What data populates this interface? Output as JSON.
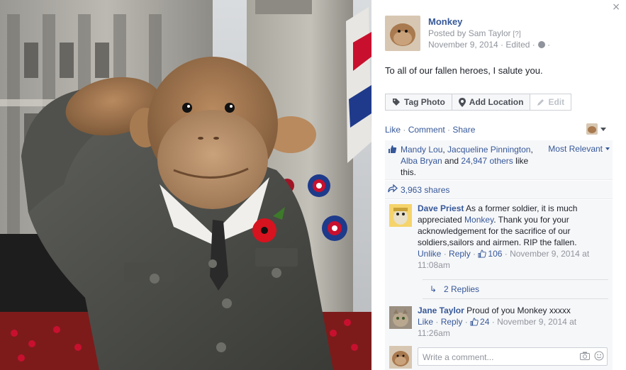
{
  "close_label": "×",
  "post": {
    "page_name": "Monkey",
    "posted_by": "Posted by Sam Taylor",
    "posted_by_help": "[?]",
    "date_line": "November 9, 2014 · Edited ·",
    "date_trail": "·",
    "privacy_icon": "globe-icon",
    "text": "To all of our fallen heroes, I salute you."
  },
  "actions": {
    "tag_photo": "Tag Photo",
    "add_location": "Add Location",
    "edit": "Edit"
  },
  "engagement": {
    "like": "Like",
    "comment": "Comment",
    "share": "Share",
    "sep": " · "
  },
  "likes": {
    "names": [
      "Mandy Lou",
      "Jacqueline Pinnington",
      "Alba Bryan"
    ],
    "sep1": ", ",
    "sep2": ",",
    "and": " and ",
    "others": "24,947 others",
    "suffix": " like this.",
    "sort_label": "Most Relevant"
  },
  "shares": {
    "label": "3,963 shares"
  },
  "comments": [
    {
      "author": "Dave Priest",
      "text_before": " As a former soldier, it is much appreciated ",
      "mention": "Monkey",
      "text_after": ". Thank you for your acknowledgement for the sacrifice of our soldiers,sailors and airmen. RIP the fallen.",
      "unlike": "Unlike",
      "reply": "Reply",
      "like_count": "106",
      "time": "November 9, 2014 at 11:08am",
      "replies": "2 Replies"
    },
    {
      "author": "Jane Taylor",
      "text": " Proud of you Monkey xxxxx",
      "like": "Like",
      "reply": "Reply",
      "like_count": "24",
      "time": "November 9, 2014 at 11:26am"
    }
  ],
  "composer": {
    "placeholder": "Write a comment..."
  },
  "colors": {
    "link": "#365899",
    "muted": "#90949c",
    "panel_bg": "#f6f7f9",
    "border": "#e9ebee"
  }
}
